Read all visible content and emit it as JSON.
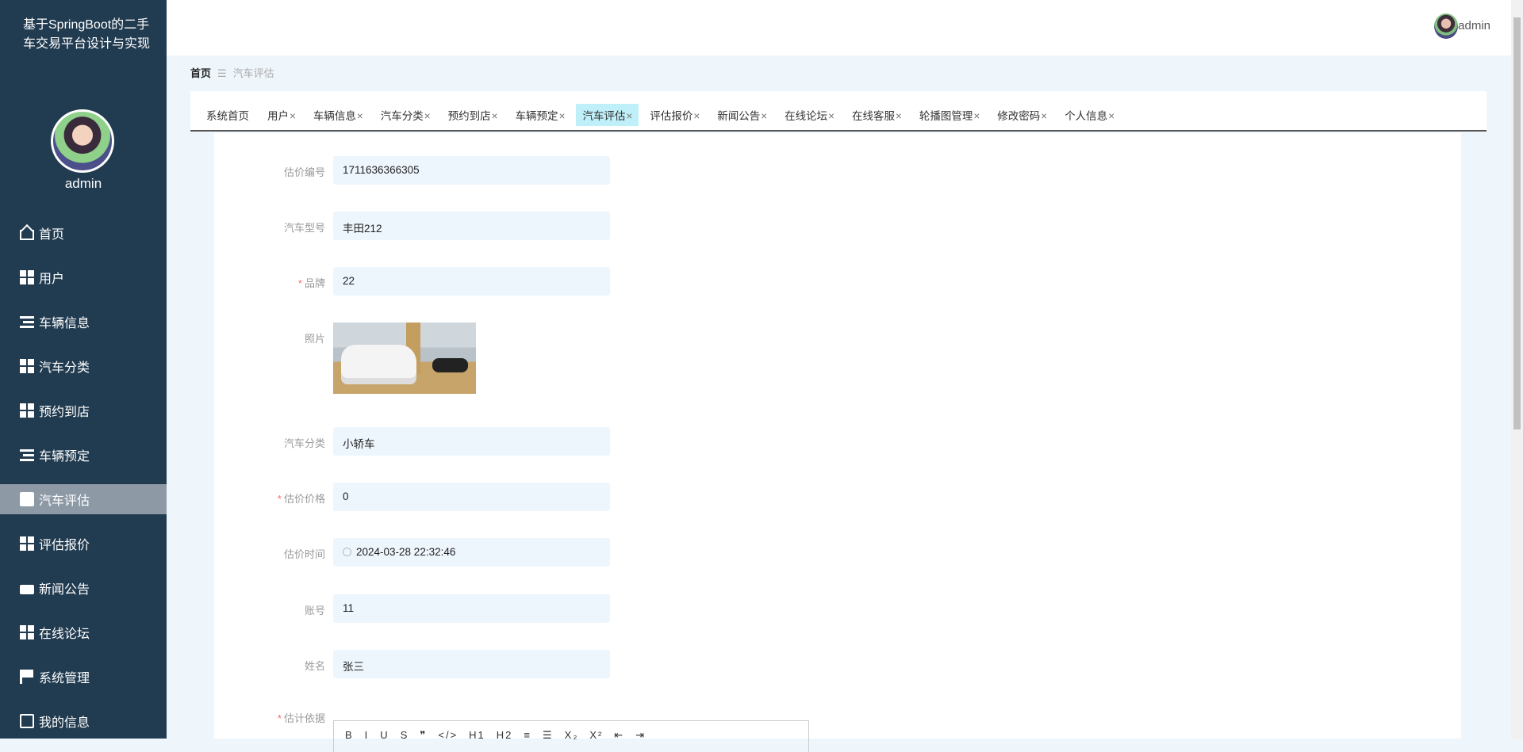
{
  "sidebar": {
    "title": "基于SpringBoot的二手车交易平台设计与实现",
    "username": "admin",
    "items": [
      {
        "label": "首页",
        "icon": "home-icon"
      },
      {
        "label": "用户",
        "icon": "grid-icon"
      },
      {
        "label": "车辆信息",
        "icon": "list-icon"
      },
      {
        "label": "汽车分类",
        "icon": "grid-icon"
      },
      {
        "label": "预约到店",
        "icon": "grid-icon"
      },
      {
        "label": "车辆预定",
        "icon": "list-icon"
      },
      {
        "label": "汽车评估",
        "icon": "clipboard-icon"
      },
      {
        "label": "评估报价",
        "icon": "grid-icon"
      },
      {
        "label": "新闻公告",
        "icon": "wallet-icon"
      },
      {
        "label": "在线论坛",
        "icon": "grid-icon"
      },
      {
        "label": "系统管理",
        "icon": "flag-icon"
      },
      {
        "label": "我的信息",
        "icon": "card-icon"
      }
    ],
    "active": "汽车评估"
  },
  "header": {
    "username": "admin"
  },
  "breadcrumb": {
    "home": "首页",
    "sep": "☰",
    "current": "汽车评估"
  },
  "tabs": [
    {
      "label": "系统首页",
      "close": ""
    },
    {
      "label": "用户",
      "close": "×"
    },
    {
      "label": "车辆信息",
      "close": "×"
    },
    {
      "label": "汽车分类",
      "close": "×"
    },
    {
      "label": "预约到店",
      "close": "×"
    },
    {
      "label": "车辆预定",
      "close": "×"
    },
    {
      "label": "汽车评估",
      "close": "×"
    },
    {
      "label": "评估报价",
      "close": "×"
    },
    {
      "label": "新闻公告",
      "close": "×"
    },
    {
      "label": "在线论坛",
      "close": "×"
    },
    {
      "label": "在线客服",
      "close": "×"
    },
    {
      "label": "轮播图管理",
      "close": "×"
    },
    {
      "label": "修改密码",
      "close": "×"
    },
    {
      "label": "个人信息",
      "close": "×"
    }
  ],
  "form": {
    "fields": [
      {
        "label": "估价编号",
        "value": "1711636366305",
        "required": ""
      },
      {
        "label": "汽车型号",
        "value": "丰田212",
        "required": ""
      },
      {
        "label": "品牌",
        "value": "22",
        "required": "*"
      },
      {
        "label": "照片",
        "required": ""
      },
      {
        "label": "汽车分类",
        "value": "小轿车",
        "required": ""
      },
      {
        "label": "估价价格",
        "value": "0",
        "required": "*"
      },
      {
        "label": "估价时间",
        "value": "2024-03-28 22:32:46",
        "required": ""
      },
      {
        "label": "账号",
        "value": "11",
        "required": ""
      },
      {
        "label": "姓名",
        "value": "张三",
        "required": ""
      },
      {
        "label": "估计依据",
        "required": "*"
      }
    ],
    "editor_toolbar": [
      "B",
      "I",
      "U",
      "S",
      "❞",
      "</>",
      "H1",
      "H2",
      "≡",
      "☰",
      "X₂",
      "X²",
      "⇤",
      "⇥"
    ]
  }
}
